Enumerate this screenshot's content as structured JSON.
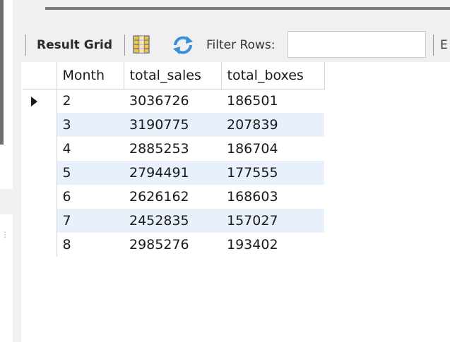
{
  "toolbar": {
    "result_grid_label": "Result Grid",
    "grid_icon": "grid-view-icon",
    "refresh_icon": "refresh-icon",
    "filter_label": "Filter Rows:",
    "filter_value": "",
    "cut_label": "E"
  },
  "grid": {
    "columns": [
      "Month",
      "total_sales",
      "total_boxes"
    ],
    "rows": [
      {
        "month": "2",
        "total_sales": "3036726",
        "total_boxes": "186501"
      },
      {
        "month": "3",
        "total_sales": "3190775",
        "total_boxes": "207839"
      },
      {
        "month": "4",
        "total_sales": "2885253",
        "total_boxes": "186704"
      },
      {
        "month": "5",
        "total_sales": "2794491",
        "total_boxes": "177555"
      },
      {
        "month": "6",
        "total_sales": "2626162",
        "total_boxes": "168603"
      },
      {
        "month": "7",
        "total_sales": "2452835",
        "total_boxes": "157027"
      },
      {
        "month": "8",
        "total_sales": "2985276",
        "total_boxes": "193402"
      }
    ],
    "current_row_index": 0,
    "alt_row_color": "#e8f0fb"
  }
}
